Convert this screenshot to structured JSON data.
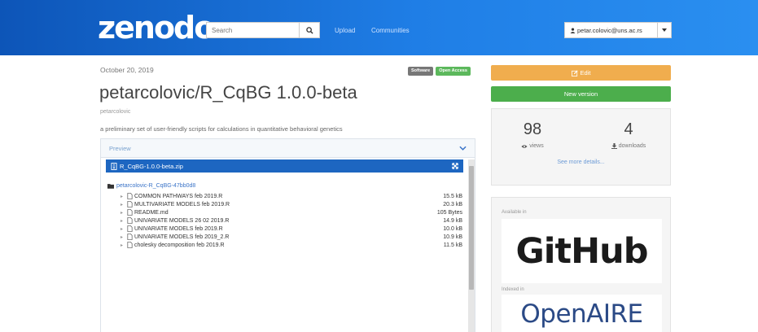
{
  "header": {
    "logo": "zenodo",
    "search_placeholder": "Search",
    "nav": {
      "upload": "Upload",
      "communities": "Communities"
    },
    "user_email": "petar.colovic@uns.ac.rs"
  },
  "record": {
    "date": "October 20, 2019",
    "badges": {
      "software": "Software",
      "open_access": "Open Access"
    },
    "title": "petarcolovic/R_CqBG 1.0.0-beta",
    "creator": "petarcolovic",
    "description": "a preliminary set of user-friendly scripts for calculations in quantitative behavioral genetics"
  },
  "preview": {
    "label": "Preview",
    "zip_name": "R_CqBG-1.0.0-beta.zip",
    "folder": "petarcolovic-R_CqBG-47bb0d8",
    "files": [
      {
        "name": "COMMON PATHWAYS feb 2019.R",
        "size": "15.5 kB"
      },
      {
        "name": "MULTIVARIATE MODELS feb 2019.R",
        "size": "20.3 kB"
      },
      {
        "name": "README.md",
        "size": "105 Bytes"
      },
      {
        "name": "UNIVARIATE MODELS 26 02 2019.R",
        "size": "14.9 kB"
      },
      {
        "name": "UNIVARIATE MODELS feb 2019.R",
        "size": "10.0 kB"
      },
      {
        "name": "UNIVARIATE MODELS feb 2019_2.R",
        "size": "10.9 kB"
      },
      {
        "name": "cholesky decomposition feb 2019.R",
        "size": "11.5 kB"
      }
    ]
  },
  "sidebar": {
    "edit_label": "Edit",
    "new_version_label": "New version",
    "stats": {
      "views": "98",
      "views_label": "views",
      "downloads": "4",
      "downloads_label": "downloads",
      "more_details": "See more details..."
    },
    "available_in_label": "Available in",
    "github_logo": "GitHub",
    "indexed_in_label": "Indexed in",
    "openaire_logo": "OpenAIRE"
  }
}
